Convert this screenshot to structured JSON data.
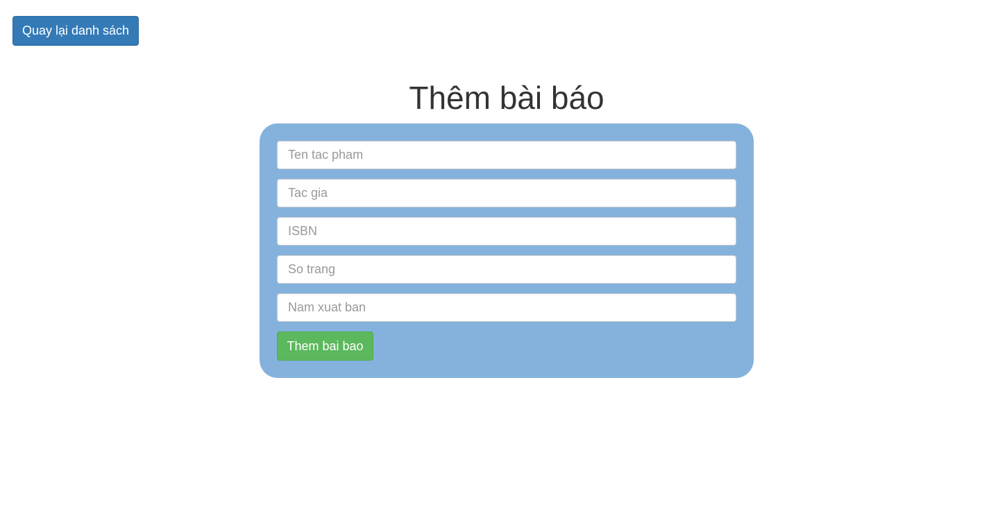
{
  "header": {
    "back_label": "Quay lại danh sách"
  },
  "main": {
    "title": "Thêm bài báo"
  },
  "form": {
    "fields": [
      {
        "placeholder": "Ten tac pham",
        "value": ""
      },
      {
        "placeholder": "Tac gia",
        "value": ""
      },
      {
        "placeholder": "ISBN",
        "value": ""
      },
      {
        "placeholder": "So trang",
        "value": ""
      },
      {
        "placeholder": "Nam xuat ban",
        "value": ""
      }
    ],
    "submit_label": "Them bai bao"
  },
  "colors": {
    "primary": "#337ab7",
    "panel": "#85b2dd",
    "success": "#5cb85c",
    "text": "#333333"
  }
}
